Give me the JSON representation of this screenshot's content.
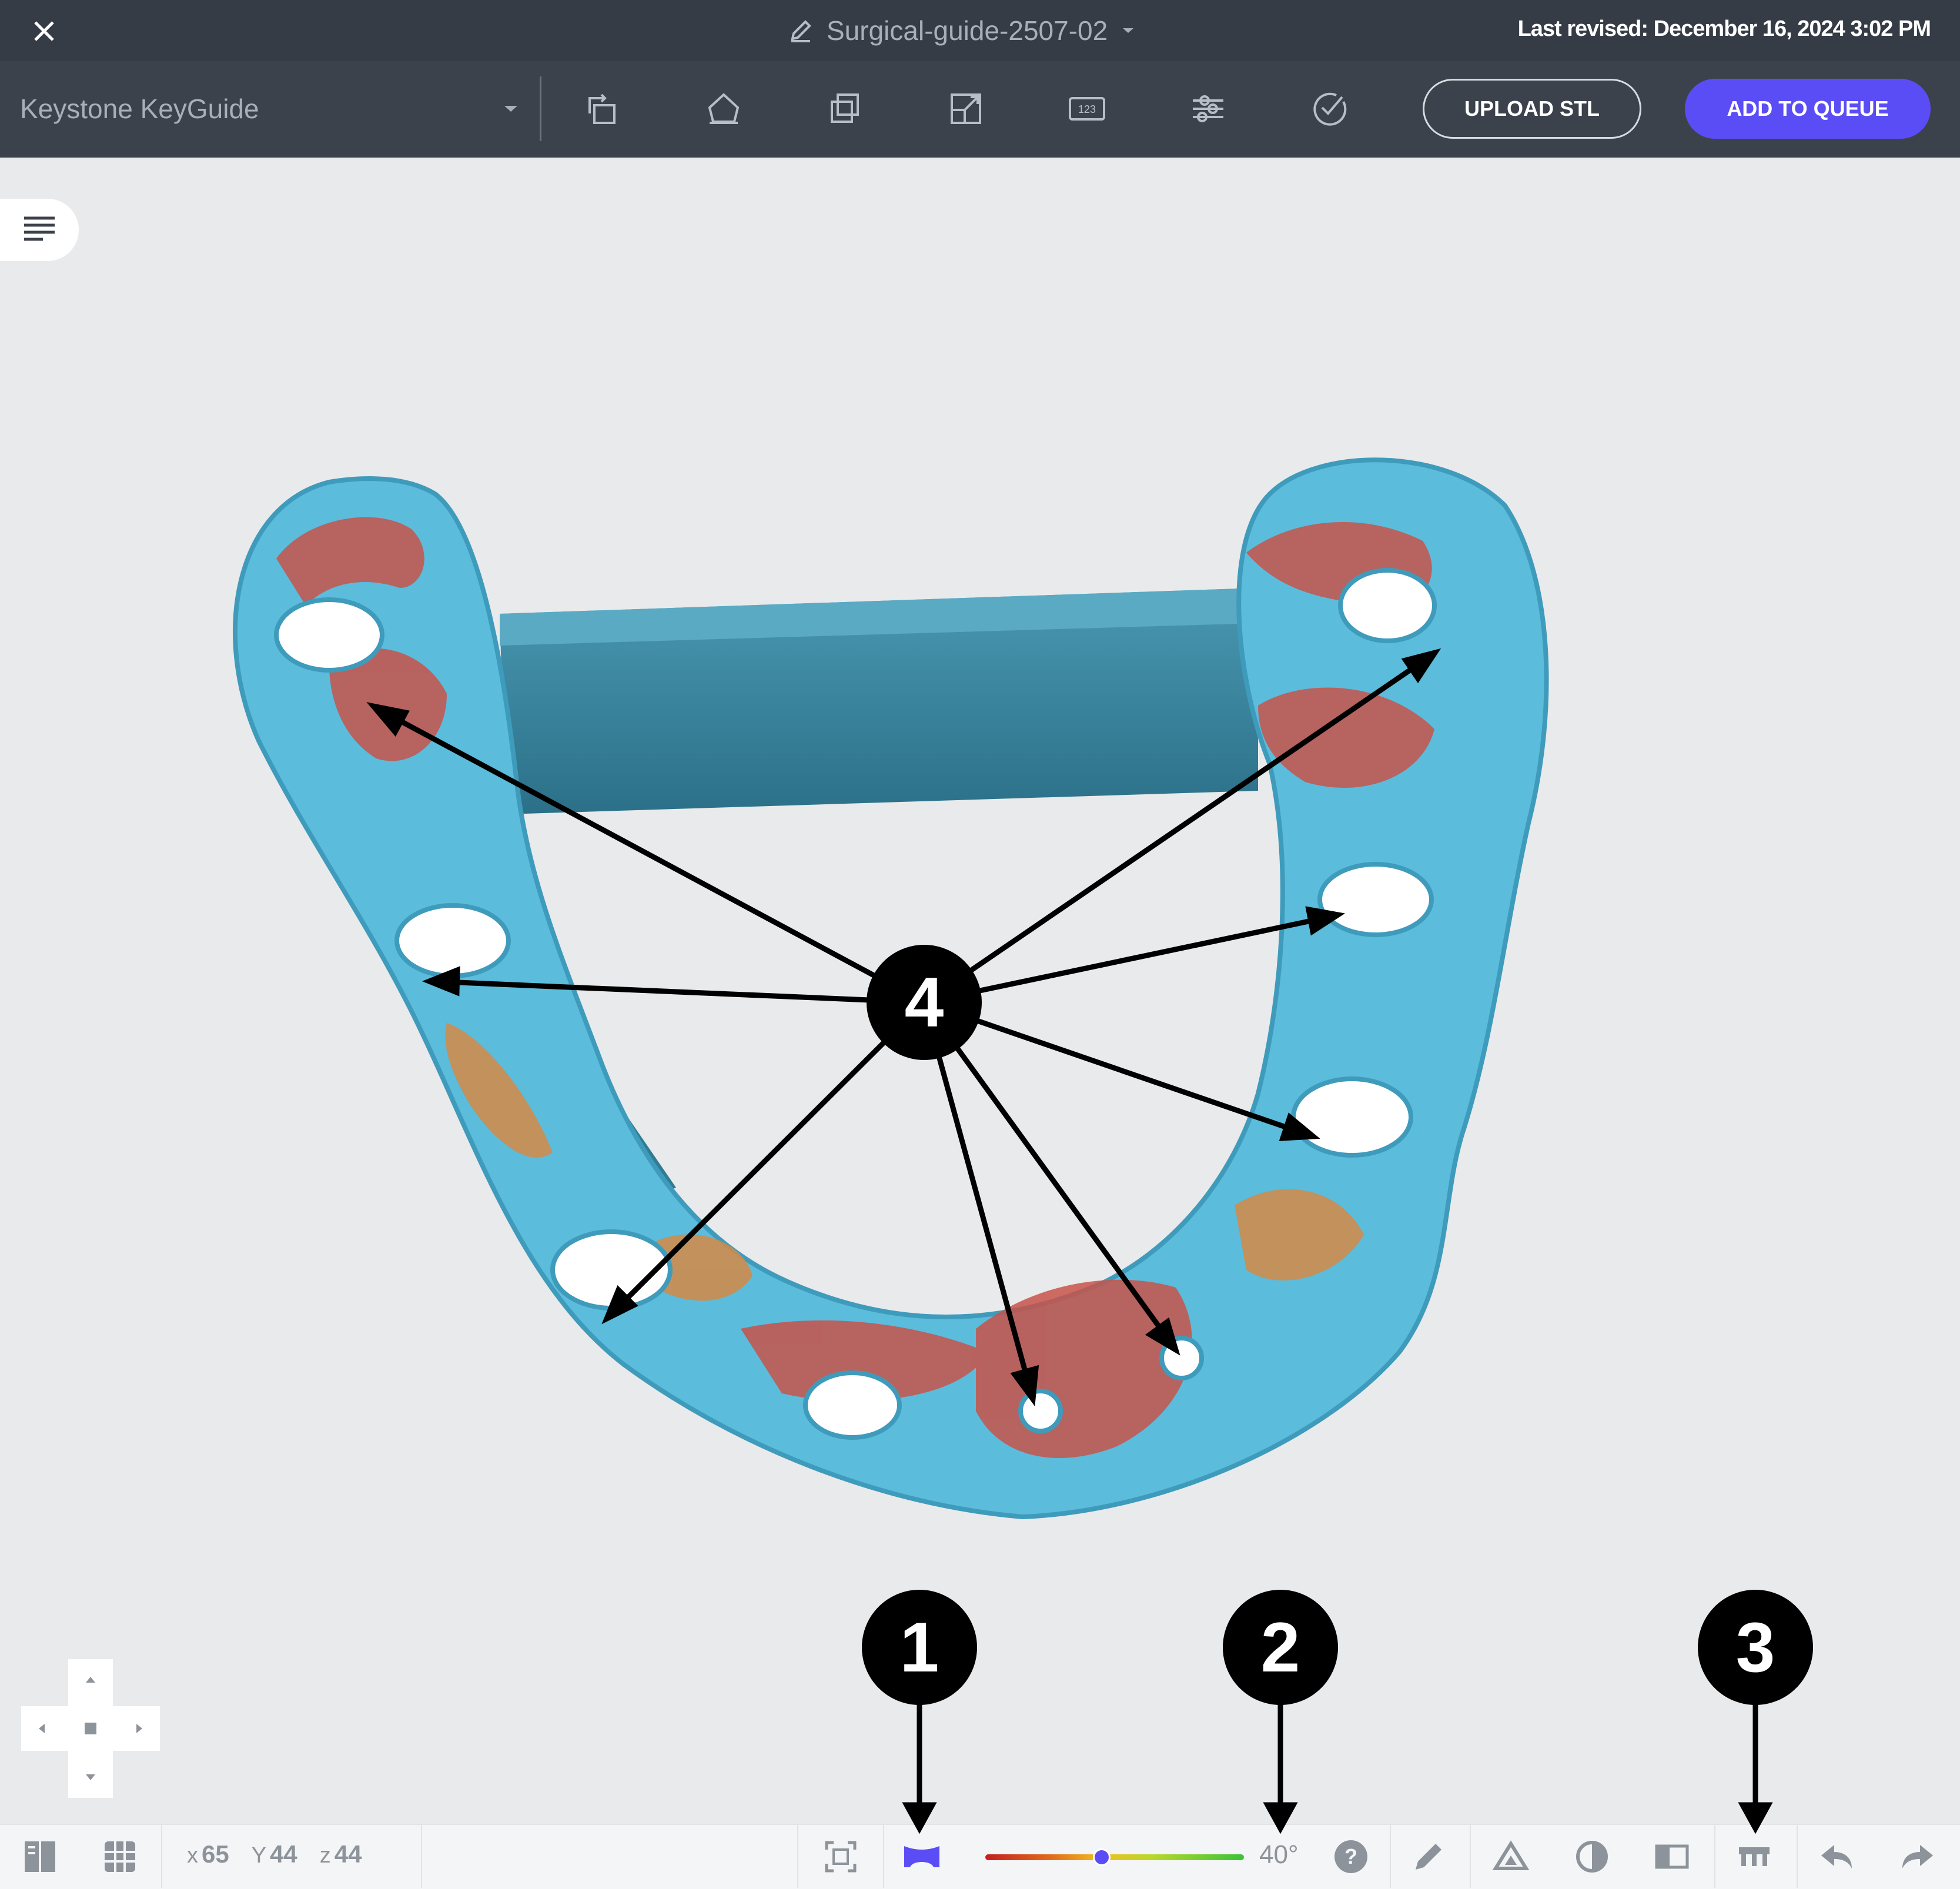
{
  "titlebar": {
    "close_icon": "close-icon",
    "document_title": "Surgical-guide-2507-02",
    "last_revised_label": "Last revised:",
    "last_revised_value": "December 16, 2024 3:02 PM"
  },
  "toolbar": {
    "material_select": "Keystone KeyGuide",
    "tools": [
      "rotate-icon",
      "orient-icon",
      "duplicate-icon",
      "scale-icon",
      "label-123-icon",
      "settings-sliders-icon",
      "verify-check-icon"
    ],
    "upload_label": "UPLOAD STL",
    "queue_label": "ADD TO QUEUE",
    "accent_color": "#5b4df5"
  },
  "viewport": {
    "menu_icon": "menu-lines-icon",
    "nav_pad_icon": "navigation-pad-icon",
    "model_colors": {
      "base": "#5ab9d8",
      "overhang_red": "#c8534a",
      "overhang_orange": "#d58a45",
      "support_bar": "#2f7d95"
    }
  },
  "bottombar": {
    "coords": {
      "x_label": "x",
      "x": "65",
      "y_label": "Y",
      "y": "44",
      "z_label": "z",
      "z": "44"
    },
    "overhang_angle": "40°",
    "slider_level": 0.45,
    "icons": [
      "layer-view-icon",
      "grid-view-icon",
      "fit-view-icon",
      "overhang-mode-icon",
      "help-icon",
      "measure-pencil-icon",
      "triangle-mesh-icon",
      "contrast-icon",
      "split-view-icon",
      "supports-icon",
      "undo-icon",
      "redo-icon"
    ]
  },
  "callouts": [
    "1",
    "2",
    "3",
    "4"
  ]
}
